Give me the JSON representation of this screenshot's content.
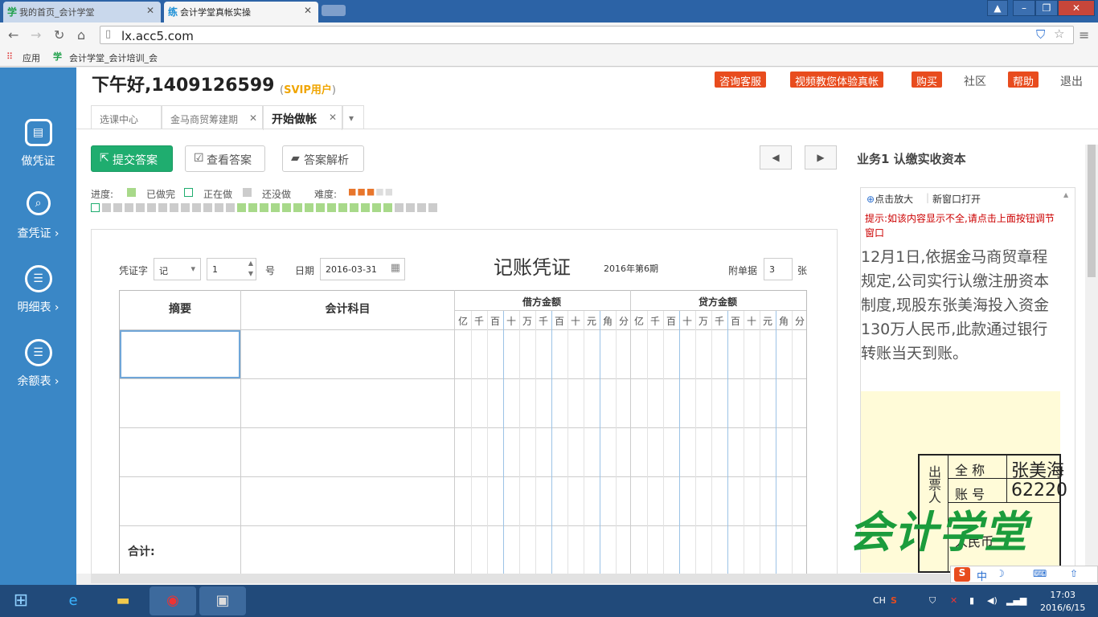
{
  "browser": {
    "tabs": [
      {
        "icon": "学",
        "title": "我的首页_会计学堂"
      },
      {
        "icon": "练",
        "title": "会计学堂真帐实操"
      }
    ],
    "url": "lx.acc5.com",
    "bookmarks": {
      "apps": "应用",
      "site_icon": "学",
      "site": "会计学堂_会计培训_会"
    }
  },
  "sidebar": [
    {
      "icon": "voucher-icon",
      "label": "做凭证"
    },
    {
      "icon": "search-icon",
      "label": "查凭证 ›"
    },
    {
      "icon": "list-icon",
      "label": "明细表 ›"
    },
    {
      "icon": "list-icon",
      "label": "余额表 ›"
    }
  ],
  "header": {
    "greeting": "下午好,1409126599",
    "svip_open": "(",
    "svip": "SVIP用户",
    "svip_close": ")",
    "links": {
      "consult": "咨询客服",
      "video": "视频教您体验真帐",
      "buy": "购买",
      "community": "社区",
      "help": "帮助",
      "logout": "退出"
    }
  },
  "page_tabs": [
    "选课中心",
    "金马商贸筹建期",
    "开始做帐"
  ],
  "toolbar": {
    "submit": "提交答案",
    "check": "查看答案",
    "analysis": "答案解析"
  },
  "business_title": "业务1  认缴实收资本",
  "progress": {
    "label": "进度:",
    "done": "已做完",
    "doing": "正在做",
    "todo": "还没做",
    "difficulty_label": "难度:",
    "difficulty_stars": 3,
    "difficulty_max": 5
  },
  "voucher": {
    "word_label": "凭证字",
    "word_value": "记",
    "number_value": "1",
    "number_unit": "号",
    "date_label": "日期",
    "date_value": "2016-03-31",
    "title": "记账凭证",
    "period": "2016年第6期",
    "attach_label": "附单据",
    "attach_value": "3",
    "attach_unit": "张",
    "col_summary": "摘要",
    "col_account": "会计科目",
    "col_debit": "借方金额",
    "col_credit": "贷方金额",
    "digits": [
      "亿",
      "千",
      "百",
      "十",
      "万",
      "千",
      "百",
      "十",
      "元",
      "角",
      "分"
    ],
    "total_label": "合计:"
  },
  "panel": {
    "zoom": "点击放大",
    "new_window": "新窗口打开",
    "hint": "提示:如该内容显示不全,请点击上面按钮调节窗口",
    "text": "12月1日,依据金马商贸章程规定,公司实行认缴注册资本制度,现股东张美海投入资金130万人民币,此款通过银行转账当天到账。",
    "receipt": {
      "side": "出票人",
      "row1_label": "全  称",
      "row1_value": "张美海",
      "row2_label": "账  号",
      "row2_value": "62220",
      "bottom": "人民币"
    }
  },
  "watermark": "会计学堂",
  "taskbar": {
    "lang": "CH",
    "ime": "中",
    "time": "17:03",
    "date": "2016/6/15"
  },
  "colors": {
    "sidebar": "#3a87c6",
    "submit": "#1fad6f",
    "accent_red": "#e84c1e",
    "done_green": "#a8d98a"
  }
}
